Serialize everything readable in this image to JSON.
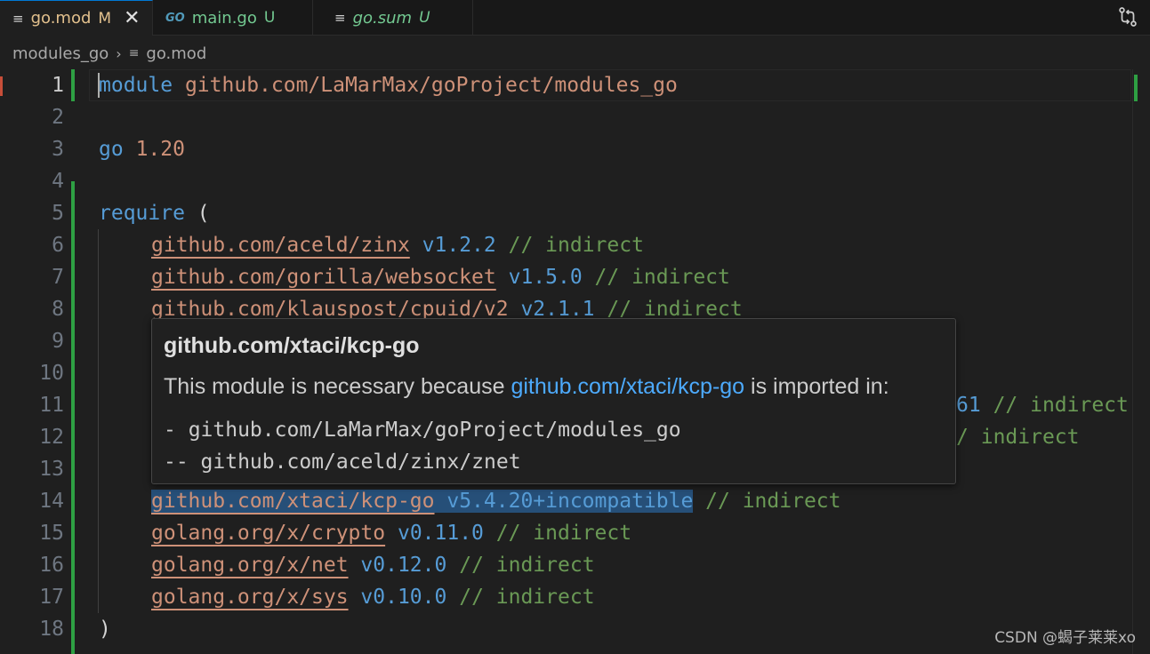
{
  "tabs": [
    {
      "icon": "≡",
      "name": "go.mod",
      "status": "M",
      "close": "✕"
    },
    {
      "icon": "GO",
      "name": "main.go",
      "status": "U"
    },
    {
      "icon": "≡",
      "name": "go.sum",
      "status": "U"
    }
  ],
  "breadcrumb": {
    "folder": "modules_go",
    "sep": "›",
    "icon": "≡",
    "file": "go.mod"
  },
  "lines": {
    "l1": {
      "n": "1",
      "kw": "module",
      "path": "github.com/LaMarMax/goProject/modules_go"
    },
    "l2": {
      "n": "2"
    },
    "l3": {
      "n": "3",
      "kw": "go",
      "ver": "1.20"
    },
    "l4": {
      "n": "4"
    },
    "l5": {
      "n": "5",
      "kw": "require",
      "paren": "("
    },
    "l6": {
      "n": "6",
      "path": "github.com/aceld/zinx",
      "ver": "v1.2.2",
      "cmt": "// indirect"
    },
    "l7": {
      "n": "7",
      "path": "github.com/gorilla/websocket",
      "ver": "v1.5.0",
      "cmt": "// indirect"
    },
    "l8": {
      "n": "8",
      "path": "github.com/klauspost/cpuid/v2",
      "ver": "v2.1.1",
      "cmt": "// indirect"
    },
    "l9": {
      "n": "9"
    },
    "l10": {
      "n": "10"
    },
    "l11": {
      "n": "11",
      "tail_ver": "61",
      "cmt": "// indirect"
    },
    "l12": {
      "n": "12",
      "tail": "/",
      "cmt": "indirect"
    },
    "l13": {
      "n": "13"
    },
    "l14": {
      "n": "14",
      "path": "github.com/xtaci/kcp-go",
      "ver": "v5.4.20+incompatible",
      "cmt": "// indirect"
    },
    "l15": {
      "n": "15",
      "path": "golang.org/x/crypto",
      "ver": "v0.11.0",
      "cmt": "// indirect"
    },
    "l16": {
      "n": "16",
      "path": "golang.org/x/net",
      "ver": "v0.12.0",
      "cmt": "// indirect"
    },
    "l17": {
      "n": "17",
      "path": "golang.org/x/sys",
      "ver": "v0.10.0",
      "cmt": "// indirect"
    },
    "l18": {
      "n": "18",
      "paren": ")"
    }
  },
  "hover": {
    "title": "github.com/xtaci/kcp-go",
    "text_before": "This module is necessary because ",
    "link": "github.com/xtaci/kcp-go",
    "text_after": " is imported in:",
    "line1": "- github.com/LaMarMax/goProject/modules_go",
    "line2": "-- github.com/aceld/zinx/znet"
  },
  "watermark": "CSDN @蝎子莱莱xo",
  "colors": {
    "keyword": "#569cd6",
    "string": "#ce9178",
    "comment": "#6a9955",
    "modified": "#e2c08d",
    "untracked": "#73c991",
    "link": "#4daafc"
  }
}
